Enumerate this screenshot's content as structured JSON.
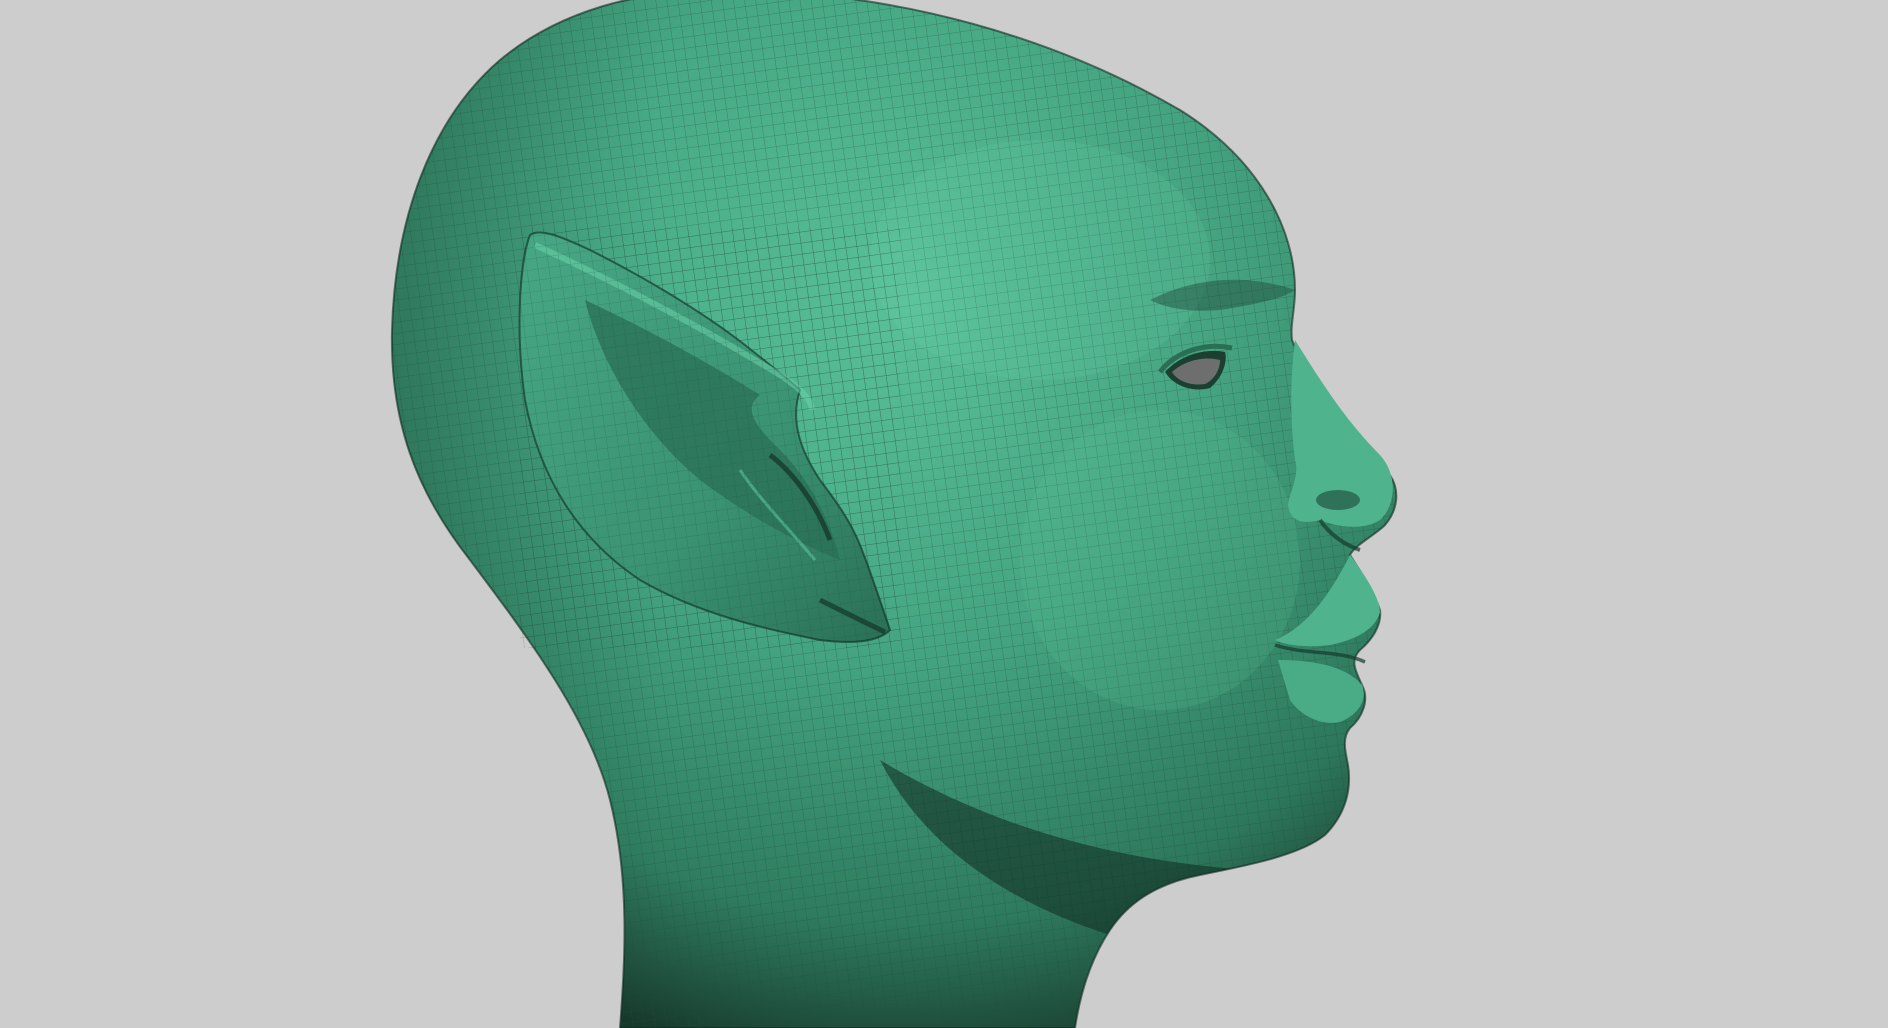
{
  "viewport": {
    "background_color": "#cdcdcd",
    "model": {
      "subject": "elf-head-wireframe-sculpt",
      "view": "profile-right",
      "mesh_color": "#3f9e7c",
      "mesh_highlight": "#5cc59d",
      "mesh_shadow": "#17392c",
      "wire_color": "#1f4d3c",
      "eye_color": "#6e6e6e"
    }
  }
}
